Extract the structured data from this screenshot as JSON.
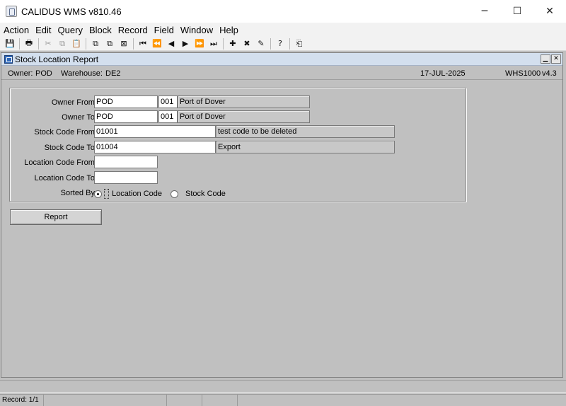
{
  "app": {
    "title": "CALIDUS WMS v810.46",
    "controls": {
      "minimize": "─",
      "maximize": "☐",
      "close": "✕"
    }
  },
  "menu": [
    "Action",
    "Edit",
    "Query",
    "Block",
    "Record",
    "Field",
    "Window",
    "Help"
  ],
  "toolbar": {
    "buttons": [
      {
        "icon": "save-icon",
        "glyph": "💾"
      },
      {
        "icon": "print-icon",
        "glyph": "🖶"
      },
      {
        "icon": "cut-icon",
        "glyph": "✂"
      },
      {
        "icon": "copy-icon",
        "glyph": "⧉"
      },
      {
        "icon": "paste-icon",
        "glyph": "📋"
      },
      {
        "icon": "duplicate-record-icon",
        "glyph": "⧉"
      },
      {
        "icon": "copy-field-icon",
        "glyph": "⧉"
      },
      {
        "icon": "clear-field-icon",
        "glyph": "⊠"
      },
      {
        "icon": "first-record-icon",
        "glyph": "⏮"
      },
      {
        "icon": "previous-set-icon",
        "glyph": "⏪"
      },
      {
        "icon": "previous-record-icon",
        "glyph": "◀"
      },
      {
        "icon": "next-record-icon",
        "glyph": "▶"
      },
      {
        "icon": "next-set-icon",
        "glyph": "⏩"
      },
      {
        "icon": "last-record-icon",
        "glyph": "⏭"
      },
      {
        "icon": "insert-record-icon",
        "glyph": "✚"
      },
      {
        "icon": "delete-record-icon",
        "glyph": "✖"
      },
      {
        "icon": "clear-record-icon",
        "glyph": "✎"
      },
      {
        "icon": "help-icon",
        "glyph": "?"
      },
      {
        "icon": "exit-icon",
        "glyph": "⎗"
      }
    ]
  },
  "form": {
    "title": "Stock Location Report",
    "controls": {
      "minimize": "▁",
      "close": "✕"
    },
    "info": {
      "owner_label": "Owner:",
      "owner": "POD",
      "warehouse_label": "Warehouse:",
      "warehouse": "DE2",
      "date": "17-JUL-2025",
      "module": "WHS1000",
      "version": "v4.3"
    },
    "owner_from": {
      "label": "Owner From:",
      "value": "POD",
      "code": "001",
      "desc": "Port of Dover"
    },
    "owner_to": {
      "label": "Owner To:",
      "value": "POD",
      "code": "001",
      "desc": "Port of Dover"
    },
    "stock_code_from": {
      "label": "Stock Code From:",
      "value": "01001",
      "desc": "test code to be deleted"
    },
    "stock_code_to": {
      "label": "Stock Code To:",
      "value": "01004",
      "desc": "Export"
    },
    "location_code_from": {
      "label": "Location Code From:",
      "value": ""
    },
    "location_code_to": {
      "label": "Location Code To:",
      "value": ""
    },
    "sorted_by": {
      "label": "Sorted By:",
      "options": [
        "Location Code",
        "Stock Code"
      ],
      "selected": "Location Code"
    },
    "report_button": "Report"
  },
  "status": {
    "message": "",
    "record": "Record: 1/1"
  }
}
